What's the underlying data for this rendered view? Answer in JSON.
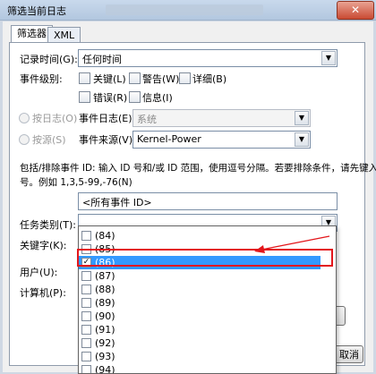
{
  "window": {
    "title": "筛选当前日志",
    "close_glyph": "✕"
  },
  "tabs": [
    "筛选器",
    "XML"
  ],
  "filter": {
    "logged_label": "记录时间(G):",
    "logged_value": "任何时间",
    "level_label": "事件级别:",
    "levels": [
      {
        "label": "关键(L)",
        "checked": false
      },
      {
        "label": "警告(W)",
        "checked": false
      },
      {
        "label": "详细(B)",
        "checked": false
      },
      {
        "label": "错误(R)",
        "checked": false
      },
      {
        "label": "信息(I)",
        "checked": false
      }
    ],
    "by_log_label": "按日志(O)",
    "event_logs_label": "事件日志(E):",
    "event_logs_value": "系统",
    "by_source_label": "按源(S)",
    "event_source_label": "事件来源(V):",
    "event_source_value": "Kernel-Power",
    "hint_line1": "包括/排除事件 ID: 输入 ID 号和/或 ID 范围，使用逗号分隔。若要排除条件，请先键入减",
    "hint_line2": "号。例如 1,3,5-99,-76(N)",
    "event_id_value": "<所有事件 ID>",
    "task_label": "任务类别(T):",
    "keywords_label": "关键字(K):",
    "user_label": "用户(U):",
    "computer_label": "计算机(P):",
    "cancel_label": "取消"
  },
  "task_category_options": [
    {
      "label": "(84)",
      "checked": false,
      "selected": false
    },
    {
      "label": "(85)",
      "checked": false,
      "selected": false
    },
    {
      "label": "(86)",
      "checked": true,
      "selected": true
    },
    {
      "label": "(87)",
      "checked": false,
      "selected": false
    },
    {
      "label": "(88)",
      "checked": false,
      "selected": false
    },
    {
      "label": "(89)",
      "checked": false,
      "selected": false
    },
    {
      "label": "(90)",
      "checked": false,
      "selected": false
    },
    {
      "label": "(91)",
      "checked": false,
      "selected": false
    },
    {
      "label": "(92)",
      "checked": false,
      "selected": false
    },
    {
      "label": "(93)",
      "checked": false,
      "selected": false
    },
    {
      "label": "(94)",
      "checked": false,
      "selected": false
    }
  ],
  "colors": {
    "selection": "#3399ff",
    "annotation": "#e3161b"
  },
  "icons": {
    "dropdown": "chevron-down-icon",
    "scroll_up": "arrow-up-icon",
    "scroll_down": "arrow-down-icon",
    "check": "checkmark-icon"
  }
}
